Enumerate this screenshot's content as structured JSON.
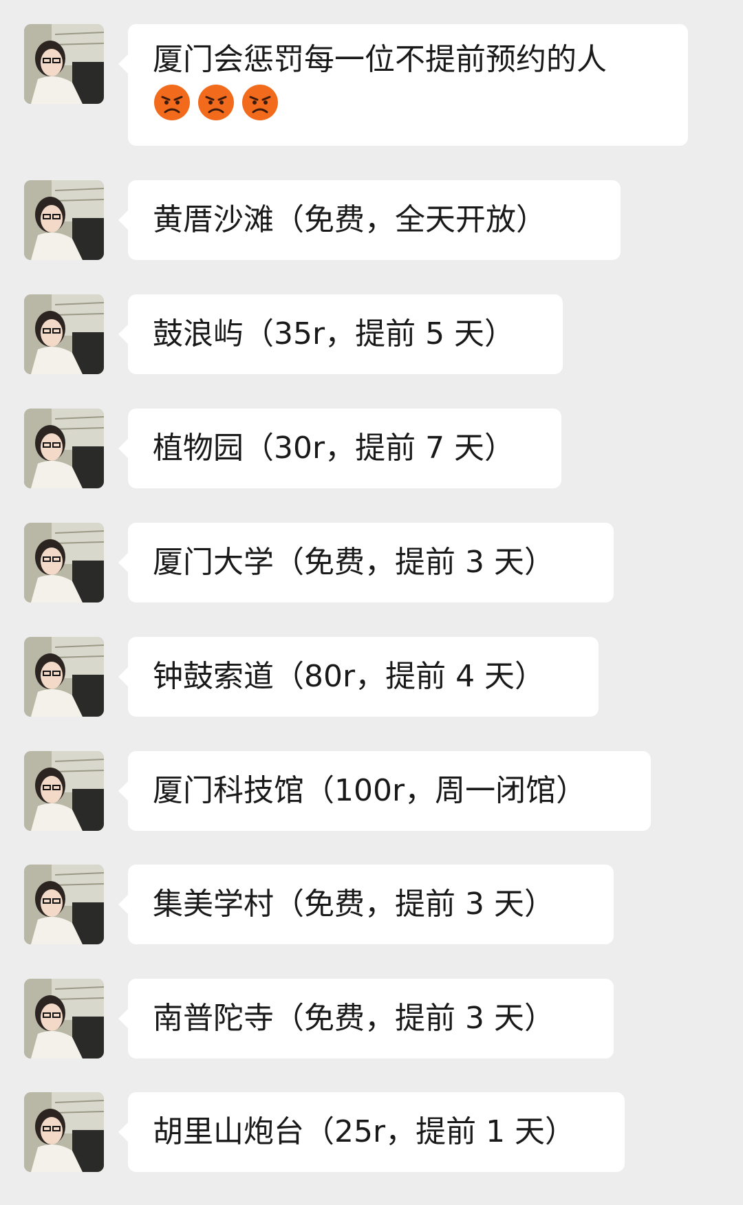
{
  "messages": [
    {
      "text": "厦门会惩罚每一位不提前预约的人",
      "emoji": [
        "angry-face",
        "angry-face",
        "angry-face"
      ]
    },
    {
      "text": "黄厝沙滩（免费，全天开放）"
    },
    {
      "text": "鼓浪屿（35r，提前 5 天）"
    },
    {
      "text": "植物园（30r，提前 7 天）"
    },
    {
      "text": "厦门大学（免费，提前 3 天）"
    },
    {
      "text": "钟鼓索道（80r，提前 4 天）"
    },
    {
      "text": "厦门科技馆（100r，周一闭馆）"
    },
    {
      "text": "集美学村（免费，提前 3 天）"
    },
    {
      "text": "南普陀寺（免费，提前 3 天）"
    },
    {
      "text": "胡里山炮台（25r，提前 1 天）"
    }
  ],
  "colors": {
    "background": "#ededed",
    "bubble": "#ffffff",
    "text": "#191919",
    "emoji": "#f26a1b"
  }
}
